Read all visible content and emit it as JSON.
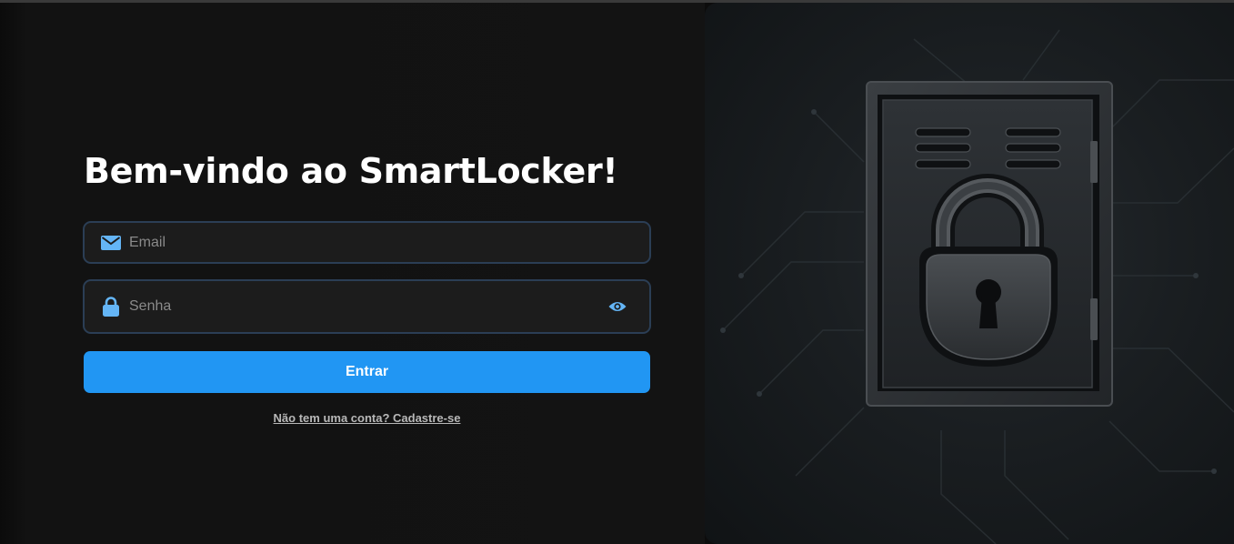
{
  "login": {
    "title": "Bem-vindo ao SmartLocker!",
    "email_placeholder": "Email",
    "password_placeholder": "Senha",
    "submit_label": "Entrar",
    "signup_link": "Não tem uma conta? Cadastre-se"
  },
  "icons": {
    "email": "envelope-icon",
    "password": "lock-icon",
    "toggle_visibility": "eye-icon",
    "illustration": "locker-padlock-illustration"
  },
  "colors": {
    "accent": "#2196f3",
    "icon": "#64b5f6",
    "background": "#131313",
    "field_background": "#1c1c1c",
    "field_border": "#2b3e55"
  }
}
